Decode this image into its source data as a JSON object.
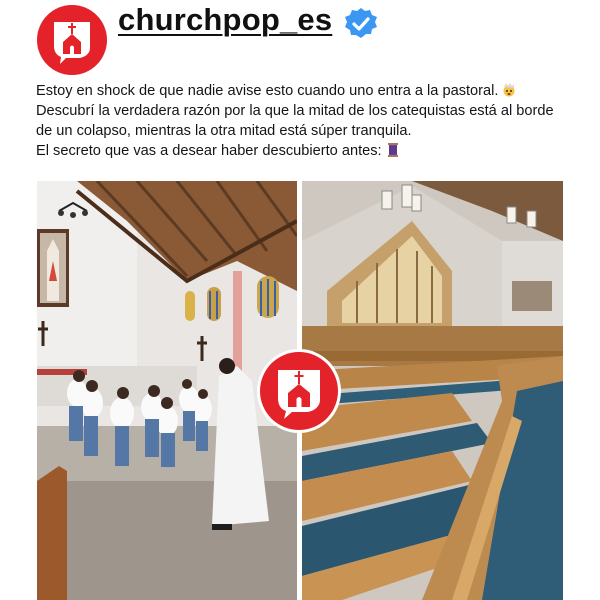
{
  "header": {
    "username": "churchpop_es",
    "avatar_icon": "churchpop-logo-icon",
    "verified_icon": "verified-badge-icon",
    "brand_color": "#e4222a",
    "verified_color": "#3b97f1"
  },
  "caption": {
    "lines": [
      "Estoy en shock de que nadie avise esto cuando uno entra a la pastoral.",
      "Descubrí la verdadera razón por la que la mitad de los catequistas está al borde",
      "de un colapso, mientras la otra mitad está súper tranquila.",
      "El secreto que vas a desear haber descubierto antes:"
    ],
    "emojis": [
      "exploding-head-emoji",
      "thread-spool-emoji"
    ]
  },
  "media": {
    "left_photo": "church-interior-kids-bowing-photo",
    "right_photo": "empty-church-pews-photo",
    "center_badge": "churchpop-logo-icon"
  }
}
